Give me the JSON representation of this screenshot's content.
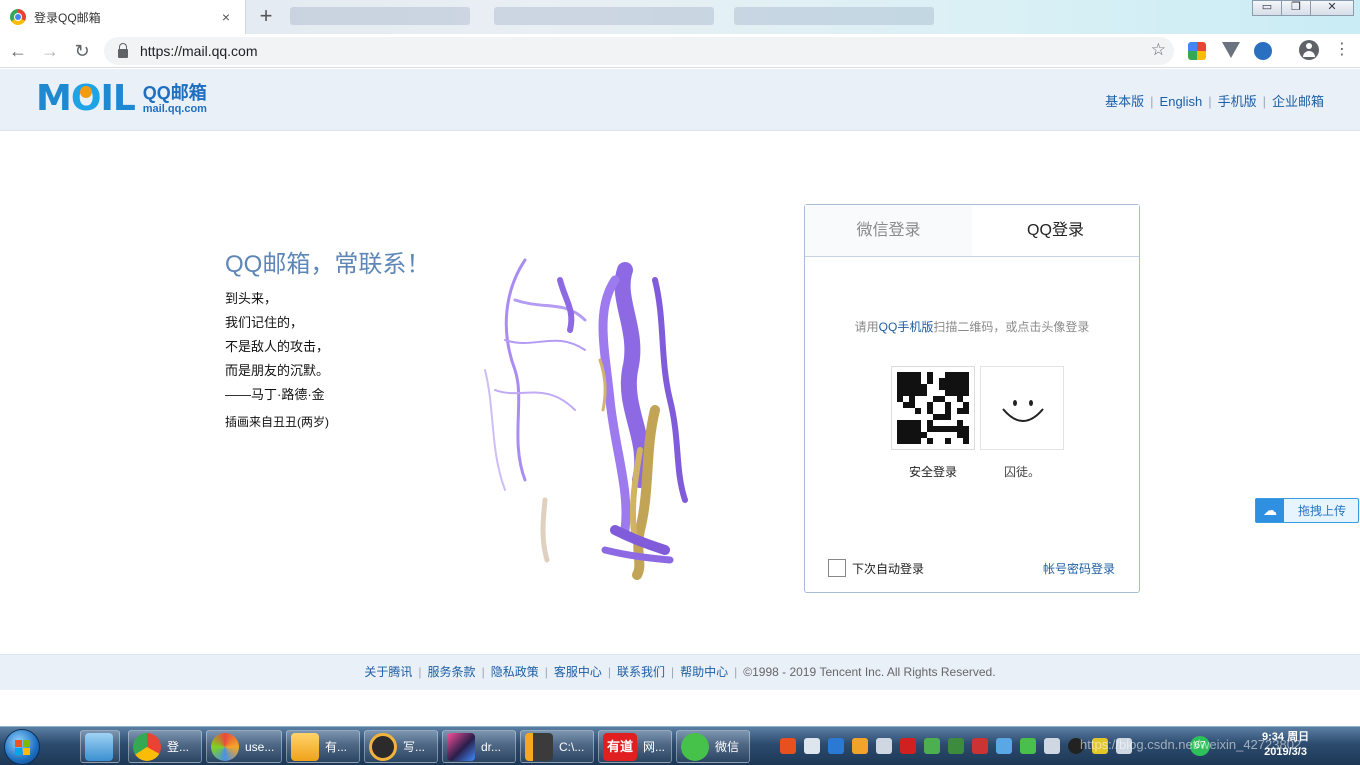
{
  "browser": {
    "active_tab": {
      "title": "登录QQ邮箱",
      "close": "×"
    },
    "new_tab": "+",
    "window_controls": {
      "minimize": "▭",
      "restore": "❐",
      "close": "✕"
    },
    "nav": {
      "back": "←",
      "forward": "→",
      "reload": "↻"
    },
    "url": "https://mail.qq.com",
    "bookmark": "☆",
    "menu": "⋮"
  },
  "header": {
    "logo_mark": "MOIL",
    "logo_cn": "QQ邮箱",
    "logo_en": "mail.qq.com",
    "links": [
      "基本版",
      "English",
      "手机版",
      "企业邮箱"
    ]
  },
  "intro": {
    "slogan": "QQ邮箱，常联系！",
    "poem": [
      "到头来，",
      "我们记住的，",
      "不是敌人的攻击，",
      "而是朋友的沉默。",
      "——马丁·路德·金"
    ],
    "credit": "插画来自丑丑(两岁)"
  },
  "login": {
    "tabs": [
      "微信登录",
      "QQ登录"
    ],
    "active_tab": "QQ登录",
    "hint_pre": "请用",
    "hint_link": "QQ手机版",
    "hint_post": "扫描二维码，或点击头像登录",
    "qr_caption": "安全登录",
    "avatar_caption": "囚徒。",
    "remember": "下次自动登录",
    "password_login": "帐号密码登录"
  },
  "float_widget": {
    "label": "拖拽上传"
  },
  "footer": {
    "links": [
      "关于腾讯",
      "服务条款",
      "隐私政策",
      "客服中心",
      "联系我们",
      "帮助中心"
    ],
    "copyright": "©1998 - 2019 Tencent Inc. All Rights Reserved."
  },
  "taskbar": {
    "items": [
      {
        "label": "登...",
        "icon": "chrome-icon"
      },
      {
        "label": "use...",
        "icon": "app-icon"
      },
      {
        "label": "有...",
        "icon": "folder-icon"
      },
      {
        "label": "写...",
        "icon": "vpn-icon"
      },
      {
        "label": "dr...",
        "icon": "intellij-icon"
      },
      {
        "label": "C:\\...",
        "icon": "sublime-icon"
      },
      {
        "label": "网...",
        "icon": "youdao-icon"
      },
      {
        "label": "微信",
        "icon": "wechat-icon"
      }
    ],
    "youdao_text": "有道",
    "clock_time": "9:34 周日",
    "clock_date": "2019/3/3",
    "battery": "67",
    "watermark": "https://blog.csdn.net/weixin_42723802"
  },
  "colors": {
    "brand_blue": "#1d5ea5",
    "header_bg": "#eaf0f8",
    "slogan": "#5e87b8",
    "paint_purple": "#7b4fe0",
    "paint_gold": "#b8953a"
  }
}
